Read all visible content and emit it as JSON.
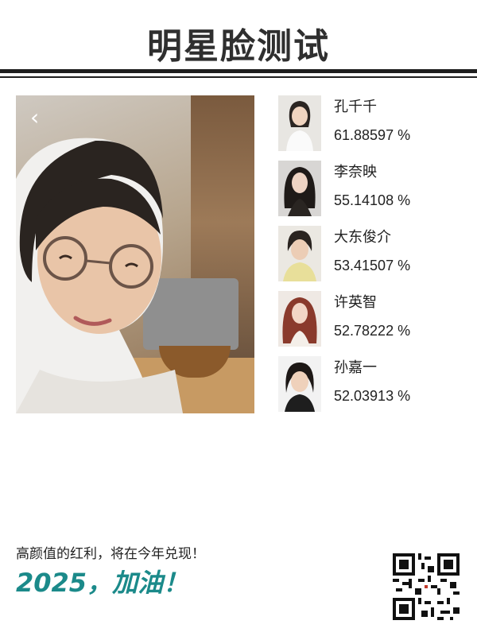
{
  "header": {
    "title": "明星脸测试"
  },
  "photo": {
    "back_icon": "chevron-left-icon"
  },
  "matches": [
    {
      "name": "孔千千",
      "score": "61.88597 %"
    },
    {
      "name": "李奈映",
      "score": "55.14108 %"
    },
    {
      "name": "大东俊介",
      "score": "53.41507 %"
    },
    {
      "name": "许英智",
      "score": "52.78222 %"
    },
    {
      "name": "孙嘉一",
      "score": "52.03913 %"
    }
  ],
  "footer": {
    "slogan": "高颜值的红利，将在今年兑现！",
    "cheer": "2025，加油！"
  },
  "colors": {
    "accent": "#1b8a8a",
    "rule": "#1f1f1f"
  }
}
